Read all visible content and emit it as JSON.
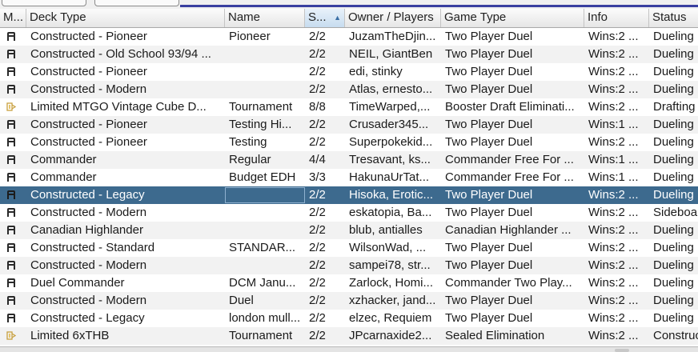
{
  "columns": [
    "M...",
    "Deck Type",
    "Name",
    "S...",
    "Owner / Players",
    "Game Type",
    "Info",
    "Status"
  ],
  "sorted_column_indicator": "▲",
  "rows": [
    {
      "icon": "constructed-icon",
      "deck": "Constructed - Pioneer",
      "name": "Pioneer",
      "seats": "2/2",
      "owner": "JuzamTheDjin...",
      "game": "Two Player Duel",
      "info": "Wins:2 ...",
      "status": "Dueling"
    },
    {
      "icon": "constructed-icon",
      "deck": "Constructed - Old School 93/94 ...",
      "name": "",
      "seats": "2/2",
      "owner": "NEIL, GiantBen",
      "game": "Two Player Duel",
      "info": "Wins:2 ...",
      "status": "Dueling"
    },
    {
      "icon": "constructed-icon",
      "deck": "Constructed - Pioneer",
      "name": "",
      "seats": "2/2",
      "owner": "edi, stinky",
      "game": "Two Player Duel",
      "info": "Wins:2 ...",
      "status": "Dueling"
    },
    {
      "icon": "constructed-icon",
      "deck": "Constructed - Modern",
      "name": "",
      "seats": "2/2",
      "owner": "Atlas, ernesto...",
      "game": "Two Player Duel",
      "info": "Wins:2 ...",
      "status": "Dueling"
    },
    {
      "icon": "limited-icon",
      "deck": "Limited MTGO Vintage Cube D...",
      "name": "Tournament",
      "seats": "8/8",
      "owner": "TimeWarped,...",
      "game": "Booster Draft Eliminati...",
      "info": "Wins:2 ...",
      "status": "Drafting"
    },
    {
      "icon": "constructed-icon",
      "deck": "Constructed - Pioneer",
      "name": "Testing Hi...",
      "seats": "2/2",
      "owner": "Crusader345...",
      "game": "Two Player Duel",
      "info": "Wins:1 ...",
      "status": "Dueling"
    },
    {
      "icon": "constructed-icon",
      "deck": "Constructed - Pioneer",
      "name": "Testing",
      "seats": "2/2",
      "owner": "Superpokekid...",
      "game": "Two Player Duel",
      "info": "Wins:2 ...",
      "status": "Dueling"
    },
    {
      "icon": "constructed-icon",
      "deck": "Commander",
      "name": "Regular",
      "seats": "4/4",
      "owner": "Tresavant, ks...",
      "game": "Commander Free For ...",
      "info": "Wins:1 ...",
      "status": "Dueling"
    },
    {
      "icon": "constructed-icon",
      "deck": "Commander",
      "name": "Budget EDH",
      "seats": "3/3",
      "owner": "HakunaUrTat...",
      "game": "Commander Free For ...",
      "info": "Wins:1 ...",
      "status": "Dueling"
    },
    {
      "icon": "constructed-icon",
      "deck": "Constructed - Legacy",
      "name": "",
      "seats": "2/2",
      "owner": "Hisoka, Erotic...",
      "game": "Two Player Duel",
      "info": "Wins:2 ...",
      "status": "Dueling",
      "selected": true
    },
    {
      "icon": "constructed-icon",
      "deck": "Constructed - Modern",
      "name": "",
      "seats": "2/2",
      "owner": "eskatopia, Ba...",
      "game": "Two Player Duel",
      "info": "Wins:2 ...",
      "status": "Sideboa"
    },
    {
      "icon": "constructed-icon",
      "deck": "Canadian Highlander",
      "name": "",
      "seats": "2/2",
      "owner": "blub, antialles",
      "game": "Canadian Highlander ...",
      "info": "Wins:2 ...",
      "status": "Dueling"
    },
    {
      "icon": "constructed-icon",
      "deck": "Constructed - Standard",
      "name": "STANDAR...",
      "seats": "2/2",
      "owner": "WilsonWad, ...",
      "game": "Two Player Duel",
      "info": "Wins:2 ...",
      "status": "Dueling"
    },
    {
      "icon": "constructed-icon",
      "deck": "Constructed - Modern",
      "name": "",
      "seats": "2/2",
      "owner": "sampei78, str...",
      "game": "Two Player Duel",
      "info": "Wins:2 ...",
      "status": "Dueling"
    },
    {
      "icon": "constructed-icon",
      "deck": "Duel Commander",
      "name": "DCM Janu...",
      "seats": "2/2",
      "owner": "Zarlock, Homi...",
      "game": "Commander Two Play...",
      "info": "Wins:2 ...",
      "status": "Dueling"
    },
    {
      "icon": "constructed-icon",
      "deck": "Constructed - Modern",
      "name": "Duel",
      "seats": "2/2",
      "owner": "xzhacker, jand...",
      "game": "Two Player Duel",
      "info": "Wins:2 ...",
      "status": "Dueling"
    },
    {
      "icon": "constructed-icon",
      "deck": "Constructed - Legacy",
      "name": "london mull...",
      "seats": "2/2",
      "owner": "elzec, Requiem",
      "game": "Two Player Duel",
      "info": "Wins:2 ...",
      "status": "Dueling"
    },
    {
      "icon": "limited-icon",
      "deck": "Limited 6xTHB",
      "name": "Tournament",
      "seats": "2/2",
      "owner": "JPcarnaxide2...",
      "game": "Sealed Elimination",
      "info": "Wins:2 ...",
      "status": "Construc"
    }
  ]
}
